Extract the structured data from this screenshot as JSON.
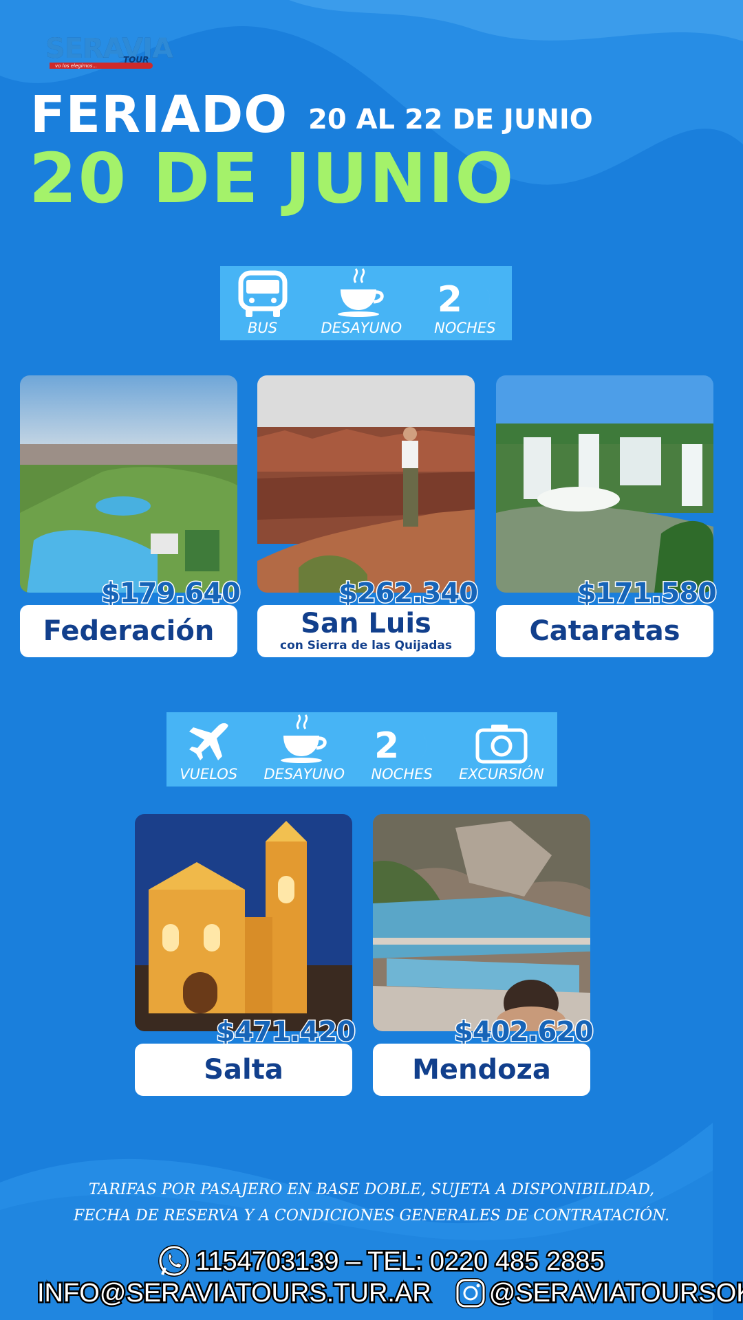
{
  "brand": {
    "logo_text": "SERAVIA",
    "logo_tour": "TOUR",
    "logo_tagline": "vo los elegimos..."
  },
  "header": {
    "feriado": "FERIADO",
    "dates": "20 AL 22 DE JUNIO",
    "main_date": "20 DE JUNIO"
  },
  "amenities_bus": [
    {
      "icon": "bus-icon",
      "label": "BUS"
    },
    {
      "icon": "coffee-cup-icon",
      "label": "DESAYUNO"
    },
    {
      "icon": "moon-icon",
      "label": "NOCHES",
      "count": "2"
    }
  ],
  "amenities_flight": [
    {
      "icon": "airplane-icon",
      "label": "VUELOS"
    },
    {
      "icon": "coffee-cup-icon",
      "label": "DESAYUNO"
    },
    {
      "icon": "moon-icon",
      "label": "NOCHES",
      "count": "2"
    },
    {
      "icon": "camera-icon",
      "label": "EXCURSIÓN"
    }
  ],
  "bus_destinations": [
    {
      "name": "Federación",
      "subtitle": "",
      "price": "$179.640",
      "image": "water-park-photo"
    },
    {
      "name": "San Luis",
      "subtitle": "con Sierra de las Quijadas",
      "price": "$262.340",
      "image": "red-canyon-photo"
    },
    {
      "name": "Cataratas",
      "subtitle": "",
      "price": "$171.580",
      "image": "waterfalls-photo"
    }
  ],
  "flight_destinations": [
    {
      "name": "Salta",
      "subtitle": "",
      "price": "$471.420",
      "image": "cathedral-photo"
    },
    {
      "name": "Mendoza",
      "subtitle": "",
      "price": "$402.620",
      "image": "hot-springs-photo"
    }
  ],
  "footer": {
    "disclaimer_line1": "TARIFAS POR PASAJERO EN BASE DOBLE, SUJETA A DISPONIBILIDAD,",
    "disclaimer_line2": "FECHA DE RESERVA Y A CONDICIONES GENERALES DE CONTRATACIÓN.",
    "phone": "1154703139 – TEL: 0220 485 2885",
    "email": "INFO@SERAVIATOURS.TUR.AR",
    "instagram": "@SERAVIATOURSOK"
  },
  "colors": {
    "background": "#1a7fdc",
    "accent_green": "#a4f26a",
    "amenity_band": "#47b4f5",
    "label_text": "#113f8c",
    "price_text": "#1664b8"
  }
}
